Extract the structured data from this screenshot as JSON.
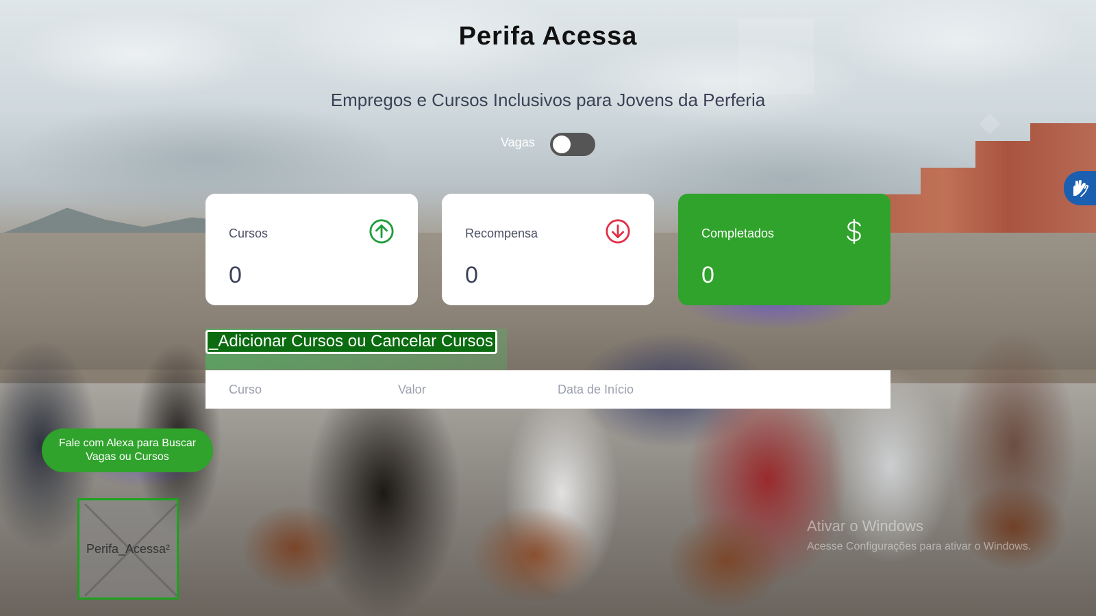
{
  "header": {
    "title": "Perifa Acessa",
    "subtitle": "Empregos e Cursos Inclusivos para Jovens da Perferia"
  },
  "toggle": {
    "label": "Vagas",
    "checked": false
  },
  "cards": [
    {
      "label": "Cursos",
      "value": "0",
      "icon": "arrow-up-circle-icon",
      "color": "#1f9d3a"
    },
    {
      "label": "Recompensa",
      "value": "0",
      "icon": "arrow-down-circle-icon",
      "color": "#e0314a"
    },
    {
      "label": "Completados",
      "value": "0",
      "icon": "dollar-icon",
      "color": "#ffffff",
      "background": "#2fa32b"
    }
  ],
  "add_courses": {
    "label": "_Adicionar Cursos ou Cancelar Cursos"
  },
  "table": {
    "columns": [
      "Curso",
      "Valor",
      "Data de Início"
    ],
    "rows": []
  },
  "alexa_button": {
    "label": "Fale com Alexa para Buscar Vagas ou Cursos"
  },
  "logo": {
    "alt_text": "Perifa_Acessa²"
  },
  "accessibility_widget": {
    "icon": "sign-language-hands-icon",
    "color": "#1b5fb0"
  },
  "os_watermark": {
    "title": "Ativar o Windows",
    "subtitle": "Acesse Configurações para ativar o Windows."
  },
  "colors": {
    "accent_green": "#2fa32b",
    "dark_green": "#0b6b10",
    "text_dark": "#3b4256"
  }
}
